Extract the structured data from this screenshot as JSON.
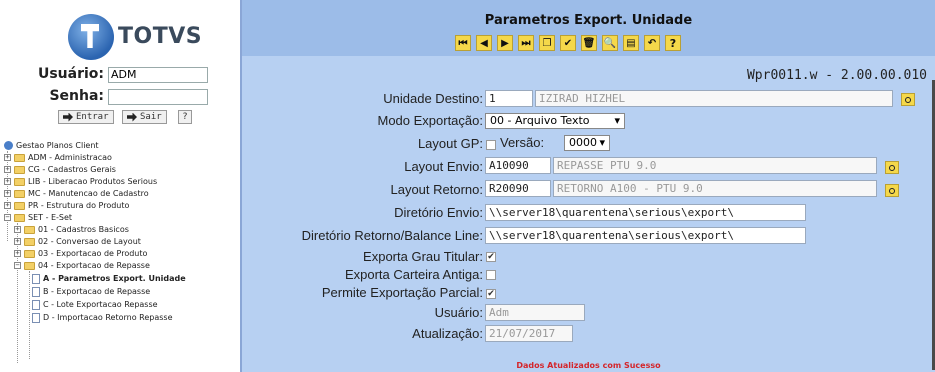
{
  "logo": {
    "text": "TOTVS"
  },
  "login": {
    "user_label": "Usuário:",
    "user_value": "ADM",
    "pass_label": "Senha:",
    "pass_value": "",
    "enter_label": "Entrar",
    "exit_label": "Sair",
    "help_label": "?"
  },
  "tree": {
    "root": "Gestao Planos Client",
    "items": [
      "ADM - Administracao",
      "CG - Cadastros Gerais",
      "LIB - Liberacao Produtos Serious",
      "MC - Manutencao de Cadastro",
      "PR - Estrutura do Produto",
      "SET - E-Set",
      "01 - Cadastros Basicos",
      "02 - Conversao de Layout",
      "03 - Exportacao de Produto",
      "04 - Exportacao de Repasse",
      "A - Parametros Export. Unidade",
      "B - Exportacao de Repasse",
      "C - Lote Exportacao Repasse",
      "D - Importacao Retorno Repasse"
    ]
  },
  "form": {
    "title": "Parametros Export. Unidade",
    "toolbar": [
      "first",
      "prev",
      "next",
      "last",
      "new",
      "save",
      "delete",
      "search",
      "list",
      "undo",
      "help"
    ],
    "toolbar_glyphs": [
      "⏮",
      "◀",
      "▶",
      "⏭",
      "❐",
      "✔",
      "🗑",
      "🔍",
      "▤",
      "↶",
      "?"
    ],
    "version": "Wpr0011.w - 2.00.00.010",
    "unidade_destino_label": "Unidade Destino:",
    "unidade_destino_code": "1",
    "unidade_destino_name": "IZIRAD HIZHEL",
    "modo_exportacao_label": "Modo Exportação:",
    "modo_exportacao_value": "00 - Arquivo Texto",
    "layout_gp_label": "Layout GP:",
    "versao_label": "Versão:",
    "versao_value": "0000",
    "layout_envio_label": "Layout Envio:",
    "layout_envio_code": "A10090",
    "layout_envio_desc": "REPASSE PTU 9.0",
    "layout_retorno_label": "Layout Retorno:",
    "layout_retorno_code": "R20090",
    "layout_retorno_desc": "RETORNO A100 - PTU 9.0",
    "dir_envio_label": "Diretório Envio:",
    "dir_envio_value": "\\\\server18\\quarentena\\serious\\export\\",
    "dir_retorno_label": "Diretório Retorno/Balance Line:",
    "dir_retorno_value": "\\\\server18\\quarentena\\serious\\export\\",
    "grau_titular_label": "Exporta Grau Titular:",
    "carteira_antiga_label": "Exporta Carteira Antiga:",
    "parcial_label": "Permite Exportação Parcial:",
    "usuario_label": "Usuário:",
    "usuario_value": "Adm",
    "atualizacao_label": "Atualização:",
    "atualizacao_value": "21/07/2017",
    "status": "Dados Atualizados com Sucesso",
    "checks": {
      "layout_gp": false,
      "grau_titular": true,
      "carteira_antiga": false,
      "parcial": true
    }
  }
}
